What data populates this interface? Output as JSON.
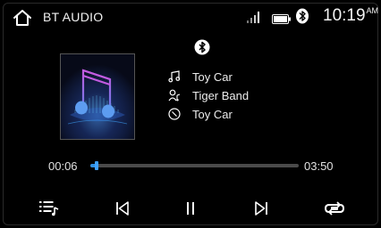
{
  "status_bar": {
    "source_title": "BT AUDIO",
    "clock_time": "10:19",
    "clock_ampm": "AM",
    "icons": [
      "home-icon",
      "signal-icon",
      "battery-icon",
      "bluetooth-icon"
    ]
  },
  "track": {
    "song": "Toy Car",
    "artist": "Tiger Band",
    "album": "Toy Car",
    "icons": [
      "music-note-icon",
      "artist-icon",
      "album-disc-icon"
    ]
  },
  "playback": {
    "elapsed": "00:06",
    "total": "03:50",
    "progress_fraction": 0.03
  },
  "controls": {
    "icons": [
      "playlist-icon",
      "previous-track-icon",
      "pause-icon",
      "next-track-icon",
      "repeat-all-icon"
    ]
  },
  "colors": {
    "background": "#000000",
    "accent": "#2f8fe0",
    "text": "#ffffff",
    "track": "#4a4a4a"
  }
}
